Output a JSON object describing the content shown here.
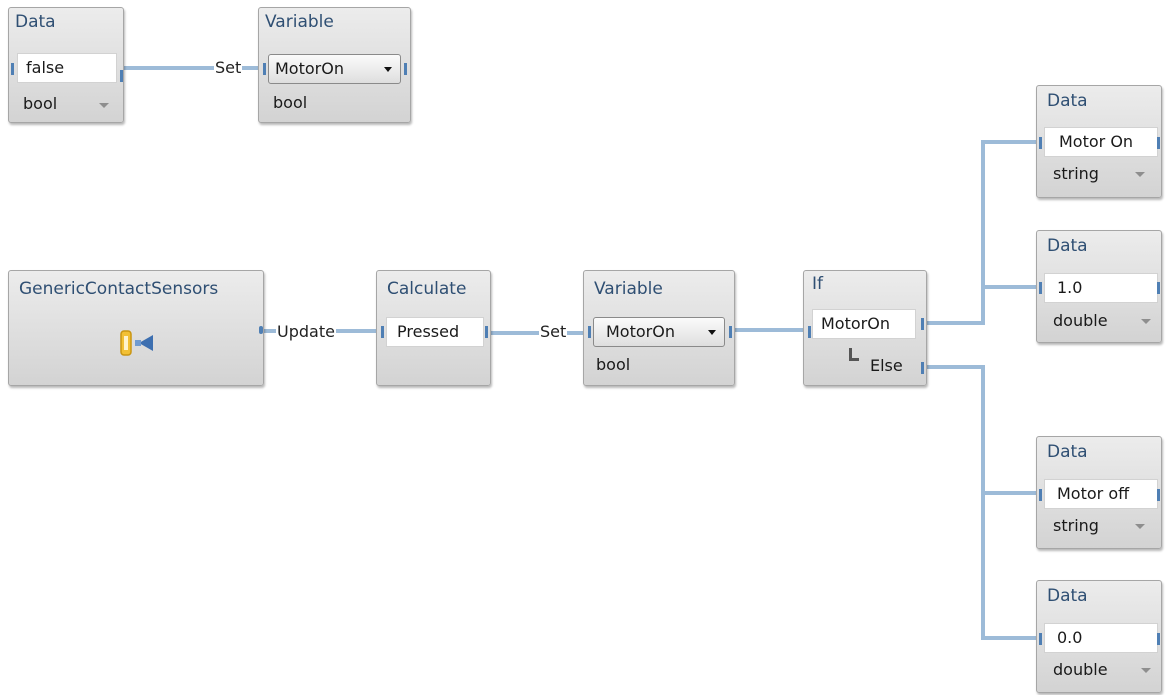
{
  "nodes": {
    "data_false": {
      "title": "Data",
      "value": "false",
      "type": "bool"
    },
    "variable_top": {
      "title": "Variable",
      "selected": "MotorOn",
      "type": "bool"
    },
    "sensors": {
      "title": "GenericContactSensors",
      "icon": "contact-sensor-icon"
    },
    "calculate": {
      "title": "Calculate",
      "value": "Pressed"
    },
    "variable_mid": {
      "title": "Variable",
      "selected": "MotorOn",
      "type": "bool"
    },
    "if_node": {
      "title": "If",
      "condition": "MotorOn",
      "else_label": "Else"
    },
    "data_motor_on": {
      "title": "Data",
      "value": "Motor On",
      "type": "string"
    },
    "data_one": {
      "title": "Data",
      "value": "1.0",
      "type": "double"
    },
    "data_motor_off": {
      "title": "Data",
      "value": "Motor off",
      "type": "string"
    },
    "data_zero": {
      "title": "Data",
      "value": "0.0",
      "type": "double"
    }
  },
  "wire_labels": {
    "set_top": "Set",
    "update": "Update",
    "set_mid": "Set"
  },
  "colors": {
    "wire": "#9dbbd8",
    "port": "#4f7fb4",
    "title_text": "#2f4f73"
  }
}
